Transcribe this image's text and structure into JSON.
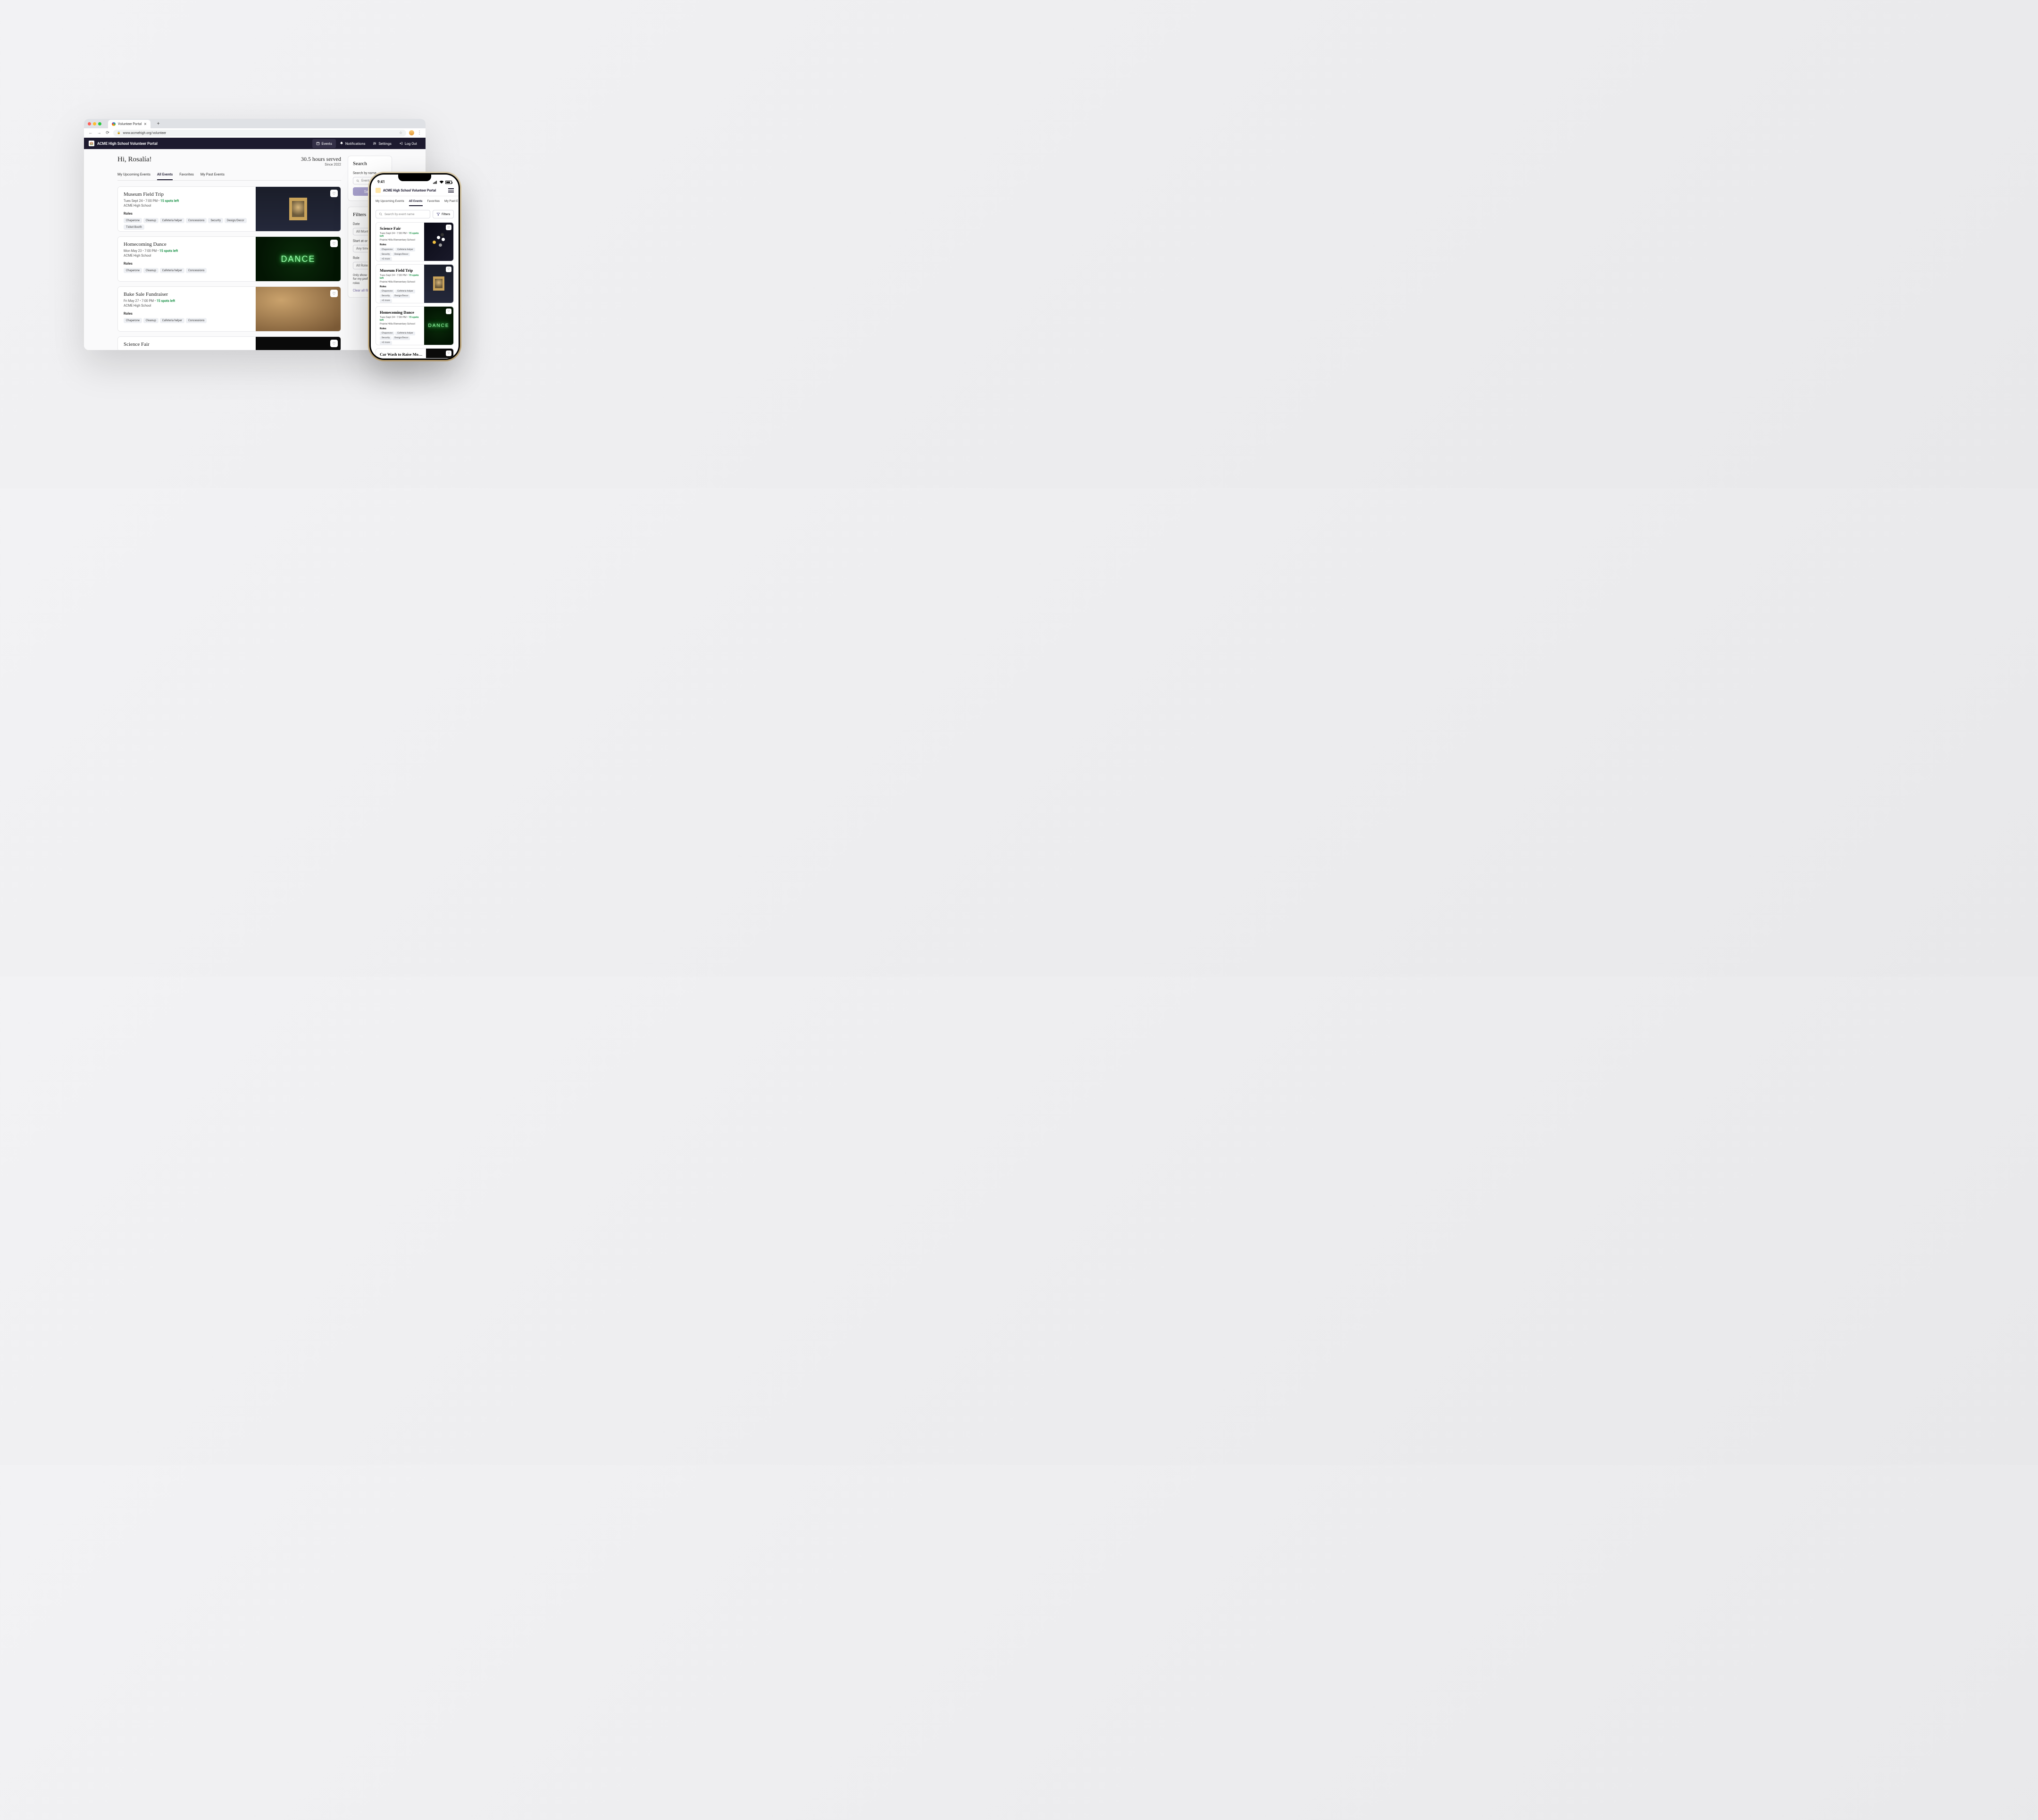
{
  "browser": {
    "tab_title": "Volunteer Portal",
    "url": "www.acmehigh.org/volunteer"
  },
  "header": {
    "app_title": "ACME High School Volunteer Portal",
    "nav": {
      "events": "Events",
      "notifications": "Notifications",
      "settings": "Settings",
      "log_out": "Log Out"
    }
  },
  "hero": {
    "greeting": "Hi, Rosalía!",
    "hours": "30.5 hours served",
    "since": "Since 2022"
  },
  "tabs": {
    "upcoming": "My Upcoming Events",
    "all": "All Events",
    "favorites": "Favorites",
    "past": "My Past Events"
  },
  "roles_label": "Roles",
  "events": [
    {
      "title": "Museum Field Trip",
      "meta": "Tues Sept 24  •  7:00 PM  •  ",
      "spots": "15 spots left",
      "school": "ACME High School",
      "chips": [
        "Chaperone",
        "Cleanup",
        "Cafeteria helper",
        "Concessions",
        "Security",
        "Design/Decor",
        "Ticket Booth"
      ]
    },
    {
      "title": "Homecoming Dance",
      "meta": "Mon May 23  •  7:00 PM  •  ",
      "spots": "15 spots left",
      "school": "ACME High School",
      "chips": [
        "Chaperone",
        "Cleanup",
        "Cafeteria helper",
        "Concessions"
      ]
    },
    {
      "title": "Bake Sale Fundraiser",
      "meta": "Fri May 27  •  7:00 PM  •  ",
      "spots": "15 spots left",
      "school": "ACME High School",
      "chips": [
        "Chaperone",
        "Cleanup",
        "Cafeteria helper",
        "Concessions"
      ]
    },
    {
      "title": "Science Fair",
      "meta": "",
      "spots": "",
      "school": "",
      "chips": []
    }
  ],
  "sidebar": {
    "search_hd": "Search",
    "search_label": "Search by name",
    "search_ph": "Event Name",
    "search_btn": "Search",
    "filters_hd": "Filters",
    "date_lbl": "Date",
    "date_val": "All Months",
    "start_lbl": "Start at or after",
    "start_val": "Any time",
    "role_lbl": "Role",
    "role_val": "All Roles",
    "toggle_text": "Only show events for my preferred roles",
    "clear": "Clear all filters"
  },
  "phone": {
    "time": "9:41",
    "app_title": "ACME High School Volunteer Portal",
    "tabs": {
      "upcoming": "My Upcoming Events",
      "all": "All Events",
      "favorites": "Favorites",
      "past": "My Past E"
    },
    "search_ph": "Search by event name",
    "filters_btn": "Filters",
    "events": [
      {
        "title": "Science Fair",
        "meta": "Tues Sept 24  •  7:00 PM  •  ",
        "spots": "15 spots left",
        "school": "Prairie Hills Elementary School",
        "chips": [
          "Chaperone",
          "Cafeteria helper",
          "Security",
          "Design/Decor",
          "+3 more"
        ]
      },
      {
        "title": "Museum Field Trip",
        "meta": "Tues Sept 24  •  7:00 PM  •  ",
        "spots": "15 spots left",
        "school": "Prairie Hills Elementary School",
        "chips": [
          "Chaperone",
          "Cafeteria helper",
          "Security",
          "Design/Decor",
          "+3 more"
        ]
      },
      {
        "title": "Homecoming Dance",
        "meta": "Tues Sept 24  •  7:00 PM  •  ",
        "spots": "15 spots left",
        "school": "Prairie Hills Elementary School",
        "chips": [
          "Chaperone",
          "Cafeteria helper",
          "Security",
          "Design/Decor",
          "+3 more"
        ]
      },
      {
        "title": "Car Wash to Raise Mo…",
        "meta": "",
        "spots": "",
        "school": "",
        "chips": []
      }
    ]
  }
}
